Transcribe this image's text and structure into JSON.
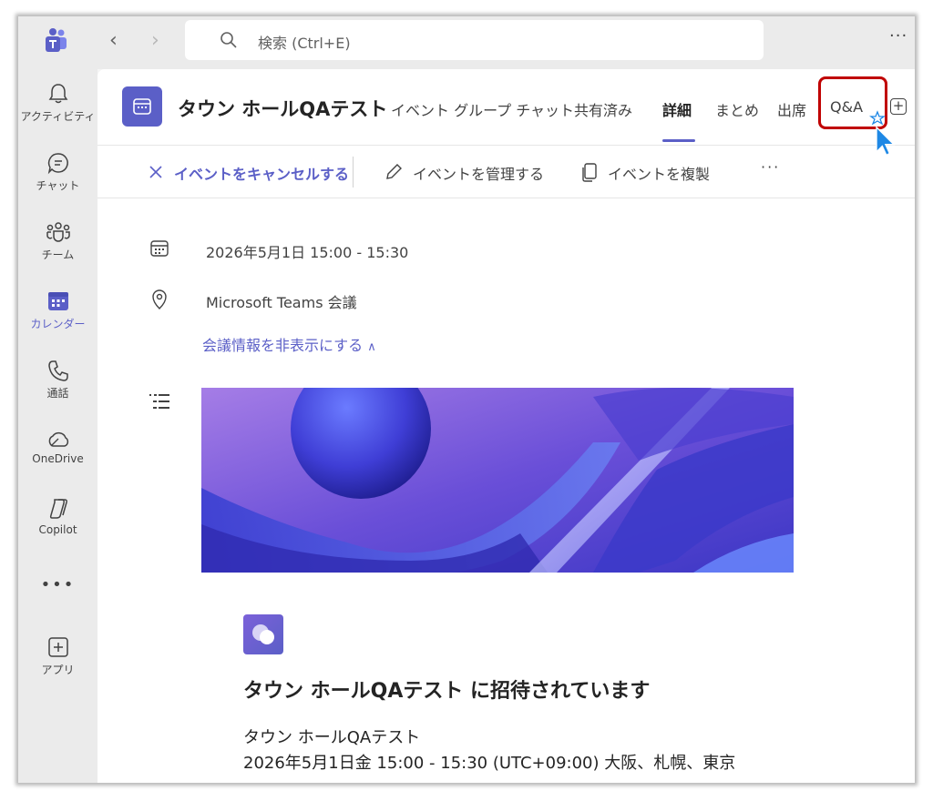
{
  "search": {
    "placeholder": "検索 (Ctrl+E)"
  },
  "rail": {
    "items": [
      {
        "label": "アクティビティ",
        "icon": "bell-icon"
      },
      {
        "label": "チャット",
        "icon": "chat-icon"
      },
      {
        "label": "チーム",
        "icon": "teams-icon"
      },
      {
        "label": "カレンダー",
        "icon": "calendar-icon"
      },
      {
        "label": "通話",
        "icon": "phone-icon"
      },
      {
        "label": "OneDrive",
        "icon": "cloud-icon"
      },
      {
        "label": "Copilot",
        "icon": "copilot-icon"
      },
      {
        "label": "アプリ",
        "icon": "plus-square-icon"
      }
    ],
    "active_index": 3
  },
  "event": {
    "title": "タウン ホールQAテスト",
    "tabs": [
      {
        "label": "イベント グループ チャット"
      },
      {
        "label": "共有済み"
      },
      {
        "label": "詳細"
      },
      {
        "label": "まとめ"
      },
      {
        "label": "出席"
      },
      {
        "label": "Q&A"
      }
    ],
    "active_tab": "詳細",
    "highlighted_tab": "Q&A"
  },
  "actions": {
    "cancel": "イベントをキャンセルする",
    "manage": "イベントを管理する",
    "duplicate": "イベントを複製"
  },
  "details": {
    "datetime": "2026年5月1日 15:00 - 15:30",
    "location": "Microsoft Teams 会議",
    "toggle": "会議情報を非表示にする"
  },
  "invite": {
    "heading": "タウン ホールQAテスト に招待されています",
    "line1": "タウン ホールQAテスト",
    "line2": "2026年5月1日金 15:00 - 15:30 (UTC+09:00) 大阪、札幌、東京"
  },
  "colors": {
    "accent": "#5b5fc7",
    "highlight_border": "#c00000",
    "cursor": "#1e88e5"
  }
}
